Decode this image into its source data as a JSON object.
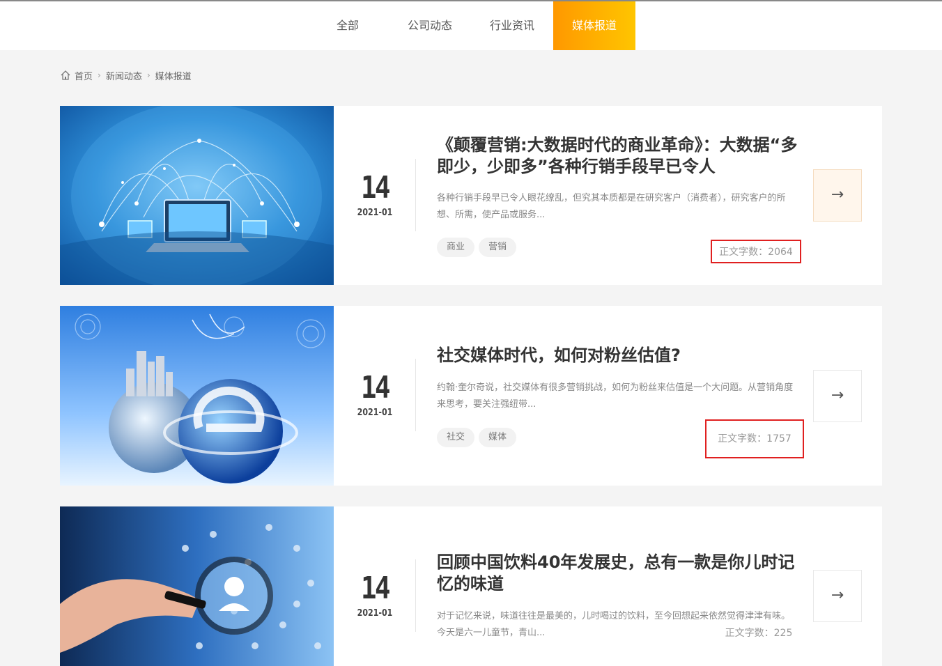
{
  "tabs": [
    {
      "label": "全部"
    },
    {
      "label": "公司动态"
    },
    {
      "label": "行业资讯"
    },
    {
      "label": "媒体报道",
      "active": true
    }
  ],
  "breadcrumb": {
    "icon": "home-icon",
    "items": [
      "首页",
      "新闻动态",
      "媒体报道"
    ]
  },
  "colors": {
    "accent_start": "#ff9800",
    "accent_end": "#ffc500",
    "highlight_box": "#e02020"
  },
  "articles": [
    {
      "day": "14",
      "yearmonth": "2021-01",
      "title": "《颠覆营销:大数据时代的商业革命》：大数据“多即少，少即多”各种行销手段早已令人",
      "desc": "各种行销手段早已令人眼花缭乱，但究其本质都是在研究客户（消费者），研究客户的所想、所需，使产品或服务...",
      "tags": [
        "商业",
        "营销"
      ],
      "word_count": "正文字数：2064",
      "arrow": "→",
      "image": "network-globe-laptop"
    },
    {
      "day": "14",
      "yearmonth": "2021-01",
      "title": "社交媒体时代，如何对粉丝估值?",
      "desc": "约翰·奎尔奇说，社交媒体有很多营销挑战，如何为粉丝来估值是一个大问题。从营销角度来思考，要关注强纽带...",
      "tags": [
        "社交",
        "媒体"
      ],
      "word_count": "正文字数：1757",
      "arrow": "→",
      "image": "globe-internet-icon"
    },
    {
      "day": "14",
      "yearmonth": "2021-01",
      "title": "回顾中国饮料40年发展史，总有一款是你儿时记忆的味道",
      "desc": "对于记忆来说，味道往往是最美的，儿时喝过的饮料，至今回想起来依然觉得津津有味。今天是六一儿童节，青山...",
      "tags": [],
      "word_count": "正文字数：225",
      "arrow": "→",
      "image": "magnifier-people"
    }
  ]
}
